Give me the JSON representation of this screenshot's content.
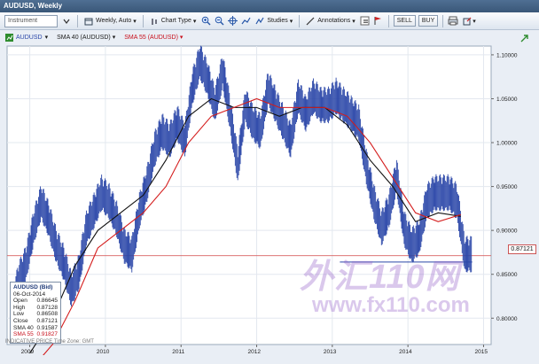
{
  "window": {
    "title": "AUDUSD, Weekly"
  },
  "toolbar": {
    "instrument_placeholder": "Instrument",
    "interval_label": "Weekly, Auto",
    "chart_type_label": "Chart Type",
    "studies_label": "Studies",
    "annotations_label": "Annotations",
    "sell_label": "SELL",
    "buy_label": "BUY"
  },
  "legend": {
    "symbol": "AUDUSD",
    "sma40": "SMA 40 (AUDUSD)",
    "sma55": "SMA 55 (AUDUSD)"
  },
  "info_box": {
    "title": "AUDUSD (Bid)",
    "date": "06-Oct-2014",
    "rows": [
      {
        "label": "Open",
        "value": "0.86645"
      },
      {
        "label": "High",
        "value": "0.87128"
      },
      {
        "label": "Low",
        "value": "0.86508"
      },
      {
        "label": "Close",
        "value": "0.87121"
      },
      {
        "label": "SMA 40",
        "value": "0.91587"
      },
      {
        "label": "SMA 55",
        "value": "0.91827"
      }
    ]
  },
  "footer": {
    "indicator_text": "INDICATIVE PRICE  Time Zone: GMT"
  },
  "last_price_label": "0.87121",
  "watermark": {
    "logo": "外汇110网",
    "url": "www.fx110.com"
  },
  "colors": {
    "price": "#2a46a8",
    "sma40": "#111111",
    "sma55": "#d41c1c",
    "background": "#ffffff"
  },
  "chart_data": {
    "type": "line",
    "title": "",
    "x_ticks": [
      "2009",
      "2010",
      "2011",
      "2012",
      "2013",
      "2014",
      "2015"
    ],
    "y_ticks": [
      "0.80000",
      "0.85000",
      "0.90000",
      "0.95000",
      "1.00000",
      "1.05000",
      "1.10000"
    ],
    "ylim": [
      0.77,
      1.11
    ],
    "xlim": [
      2008.7,
      2015.1
    ],
    "grid": true,
    "series": [
      {
        "name": "AUDUSD",
        "x": [
          2008.75,
          2008.85,
          2008.95,
          2009.05,
          2009.15,
          2009.25,
          2009.35,
          2009.45,
          2009.55,
          2009.65,
          2009.75,
          2009.85,
          2009.95,
          2010.05,
          2010.15,
          2010.25,
          2010.35,
          2010.45,
          2010.55,
          2010.65,
          2010.75,
          2010.85,
          2010.95,
          2011.05,
          2011.15,
          2011.25,
          2011.35,
          2011.45,
          2011.55,
          2011.65,
          2011.75,
          2011.85,
          2011.95,
          2012.05,
          2012.15,
          2012.25,
          2012.35,
          2012.45,
          2012.55,
          2012.65,
          2012.75,
          2012.85,
          2012.95,
          2013.05,
          2013.15,
          2013.25,
          2013.35,
          2013.45,
          2013.55,
          2013.65,
          2013.75,
          2013.85,
          2013.95,
          2014.05,
          2014.15,
          2014.25,
          2014.35,
          2014.45,
          2014.55,
          2014.65,
          2014.75
        ],
        "y": [
          0.8,
          0.84,
          0.86,
          0.9,
          0.93,
          0.91,
          0.88,
          0.86,
          0.83,
          0.85,
          0.9,
          0.92,
          0.94,
          0.93,
          0.91,
          0.88,
          0.87,
          0.92,
          0.95,
          0.99,
          1.01,
          1.0,
          1.02,
          1.0,
          1.06,
          1.09,
          1.07,
          1.04,
          1.08,
          1.03,
          0.97,
          1.04,
          1.02,
          1.01,
          1.06,
          1.04,
          1.02,
          1.0,
          1.05,
          1.03,
          1.05,
          1.04,
          1.04,
          1.05,
          1.04,
          1.03,
          1.02,
          0.97,
          0.93,
          0.9,
          0.92,
          0.96,
          0.9,
          0.88,
          0.89,
          0.93,
          0.94,
          0.94,
          0.94,
          0.93,
          0.87
        ]
      },
      {
        "name": "SMA 40",
        "x": [
          2009.0,
          2009.3,
          2009.6,
          2009.9,
          2010.2,
          2010.5,
          2010.8,
          2011.1,
          2011.4,
          2011.7,
          2012.0,
          2012.3,
          2012.6,
          2012.9,
          2013.2,
          2013.5,
          2013.8,
          2014.1,
          2014.4,
          2014.7
        ],
        "y": [
          0.76,
          0.8,
          0.86,
          0.9,
          0.92,
          0.94,
          0.98,
          1.03,
          1.05,
          1.04,
          1.04,
          1.03,
          1.04,
          1.04,
          1.02,
          0.98,
          0.95,
          0.91,
          0.92,
          0.916
        ]
      },
      {
        "name": "SMA 55",
        "x": [
          2009.0,
          2009.3,
          2009.6,
          2009.9,
          2010.2,
          2010.5,
          2010.8,
          2011.1,
          2011.4,
          2011.7,
          2012.0,
          2012.3,
          2012.6,
          2012.9,
          2013.2,
          2013.5,
          2013.8,
          2014.1,
          2014.4,
          2014.7
        ],
        "y": [
          0.74,
          0.77,
          0.82,
          0.88,
          0.9,
          0.92,
          0.95,
          1.0,
          1.03,
          1.04,
          1.05,
          1.04,
          1.04,
          1.04,
          1.03,
          1.0,
          0.96,
          0.92,
          0.91,
          0.918
        ]
      }
    ]
  }
}
